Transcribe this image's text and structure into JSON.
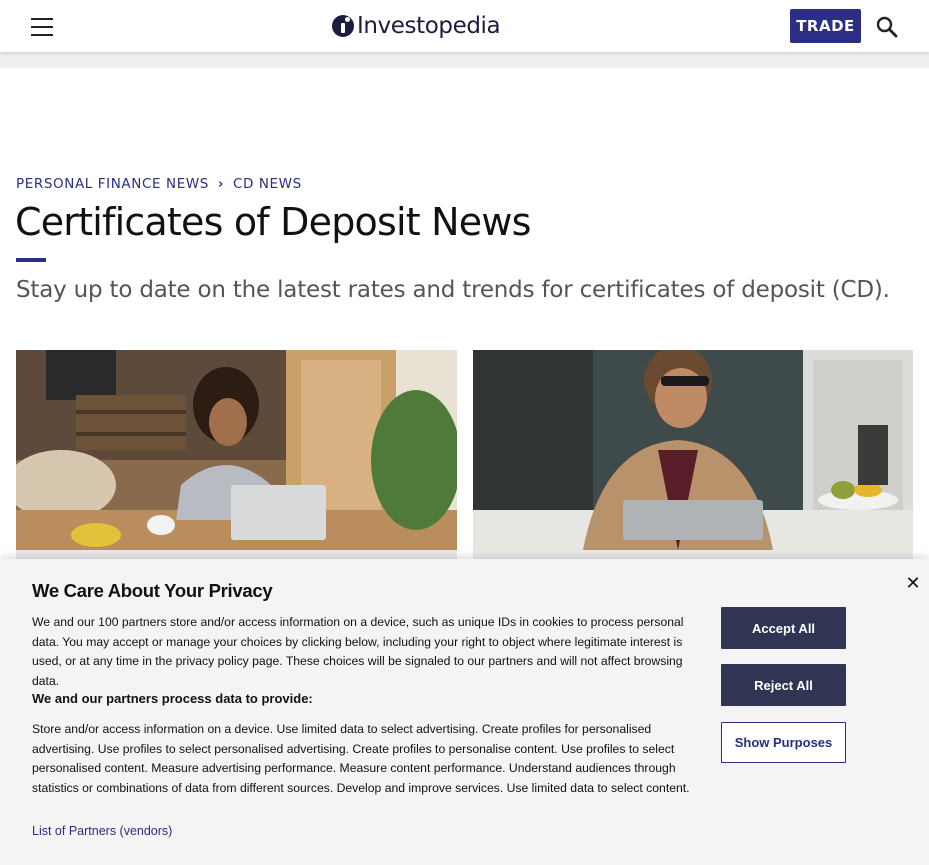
{
  "header": {
    "logo_text": "Investopedia",
    "trade_label": "TRADE",
    "icons": {
      "menu": "hamburger-menu-icon",
      "search": "search-icon",
      "logo": "investopedia-logo-icon"
    }
  },
  "breadcrumb": {
    "items": [
      "PERSONAL FINANCE NEWS",
      "CD NEWS"
    ],
    "separator": "›"
  },
  "page": {
    "title": "Certificates of Deposit News",
    "subtitle": "Stay up to date on the latest rates and trends for certificates of deposit (CD)."
  },
  "privacy": {
    "title": "We Care About Your Privacy",
    "body": "We and our 100 partners store and/or access information on a device, such as unique IDs in cookies to process personal data. You may accept or manage your choices by clicking below, including your right to object where legitimate interest is used, or at any time in the privacy policy page. These choices will be signaled to our partners and will not affect browsing data.",
    "subheading": "We and our partners process data to provide:",
    "purposes": "Store and/or access information on a device. Use limited data to select advertising. Create profiles for personalised advertising. Use profiles to select personalised advertising. Create profiles to personalise content. Use profiles to select personalised content. Measure advertising performance. Measure content performance. Understand audiences through statistics or combinations of data from different sources. Develop and improve services. Use limited data to select content.",
    "partners_link": "List of Partners (vendors)",
    "accept_label": "Accept All",
    "reject_label": "Reject All",
    "purposes_label": "Show Purposes",
    "close_glyph": "✕"
  },
  "colors": {
    "brand": "#2c2d84",
    "button_dark": "#2f3552",
    "banner_bg": "#f4f4f4"
  }
}
